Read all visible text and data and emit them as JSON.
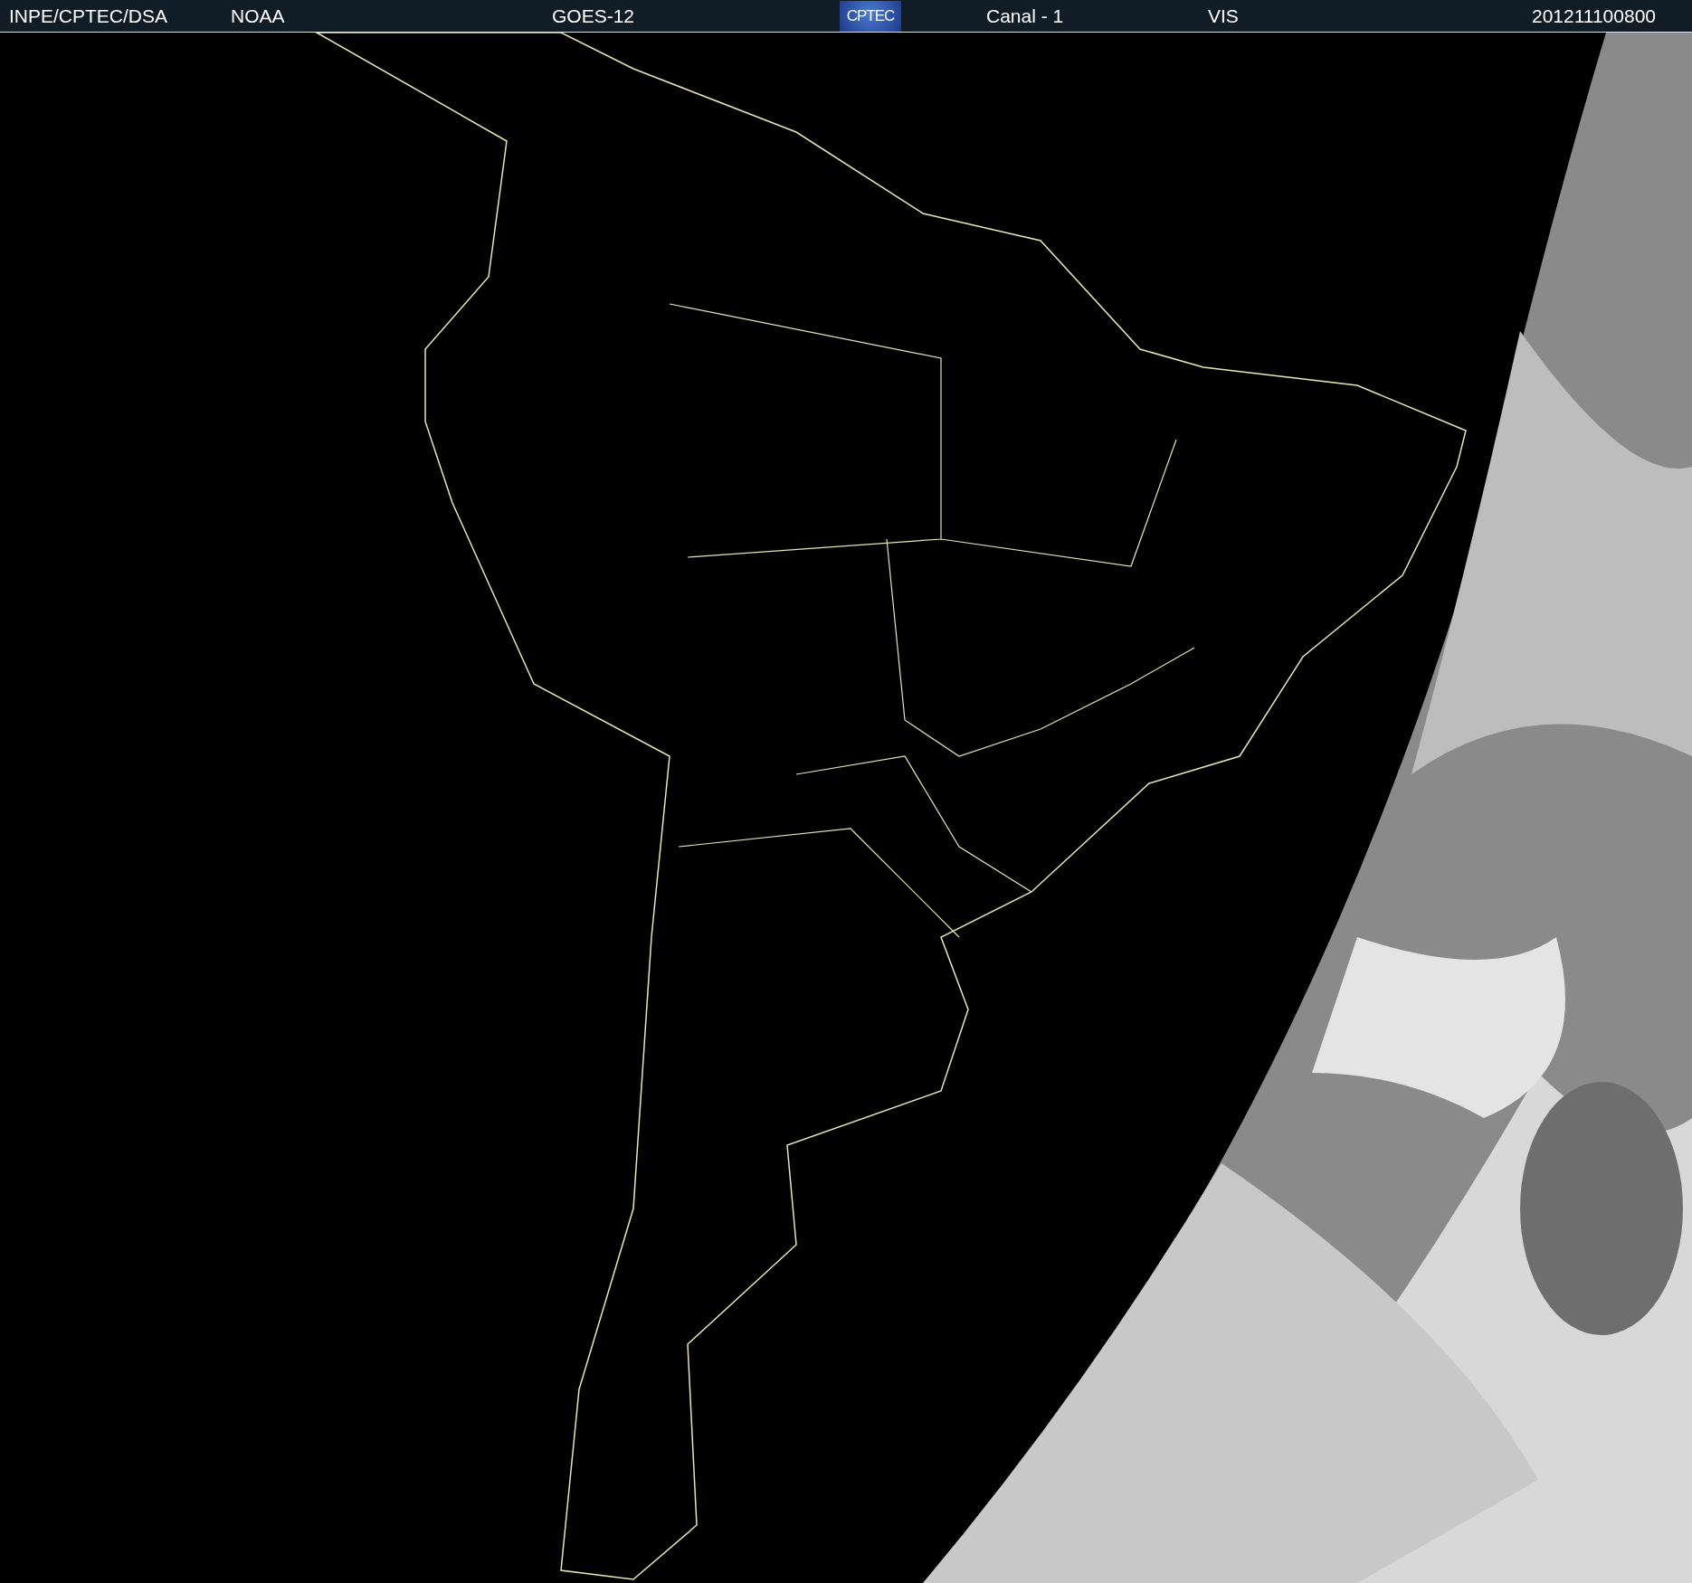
{
  "header": {
    "items": [
      {
        "kind": "text",
        "text": "INPE/CPTEC/DSA"
      },
      {
        "kind": "text",
        "text": "NOAA"
      },
      {
        "kind": "text",
        "text": "GOES-12"
      },
      {
        "kind": "logo",
        "text": "CPTEC"
      },
      {
        "kind": "text",
        "text": "Canal - 1"
      },
      {
        "kind": "text",
        "text": "VIS"
      },
      {
        "kind": "text",
        "text": "201211100800"
      }
    ]
  }
}
